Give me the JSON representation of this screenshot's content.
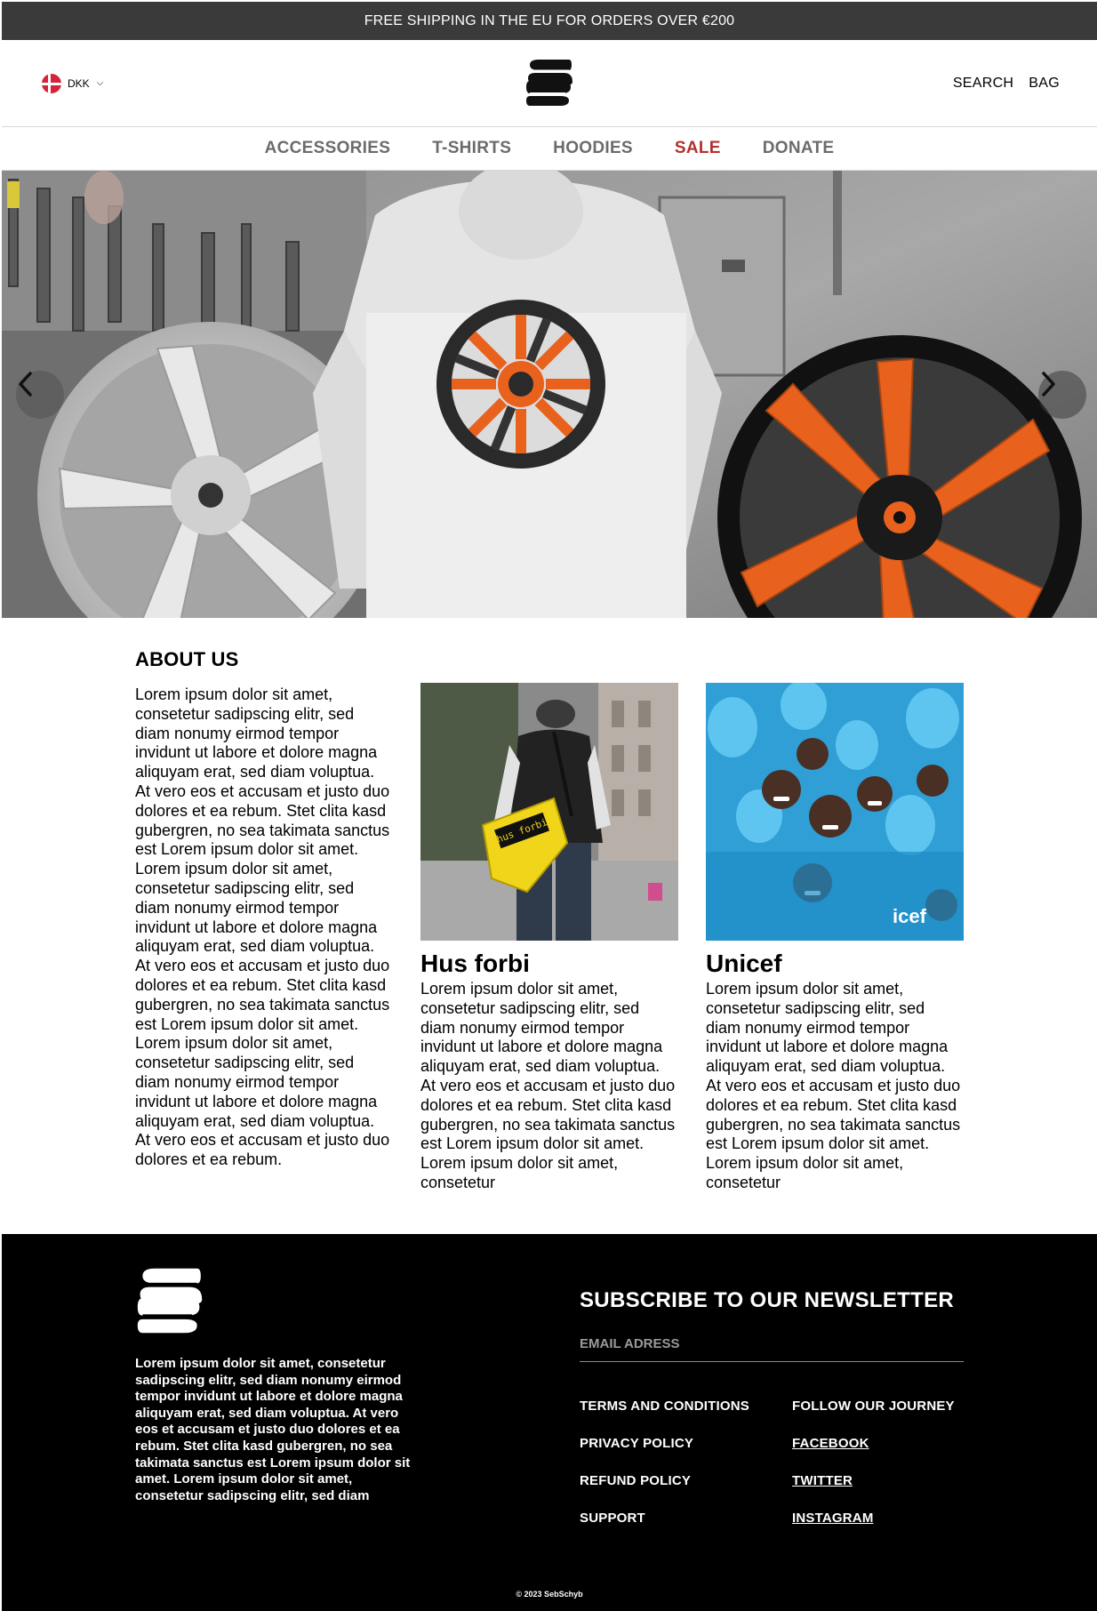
{
  "announcement": {
    "text": "FREE SHIPPING IN THE EU FOR ORDERS OVER €200"
  },
  "header": {
    "currency": "DKK",
    "search_label": "SEARCH",
    "bag_label": "BAG"
  },
  "nav": {
    "items": [
      {
        "label": "ACCESSORIES"
      },
      {
        "label": "T-SHIRTS"
      },
      {
        "label": "HOODIES"
      },
      {
        "label": "SALE"
      },
      {
        "label": "DONATE"
      }
    ]
  },
  "colors": {
    "announcement_bg": "#3a3a3a",
    "sale": "#b2302f",
    "nav_text": "#6b6b6b",
    "footer_bg": "#000000",
    "accent_orange": "#e8621e"
  },
  "about": {
    "title": "ABOUT US",
    "text": "Lorem ipsum dolor sit amet, consetetur sadipscing elitr, sed diam nonumy eirmod tempor invidunt ut labore et dolore magna aliquyam erat, sed diam voluptua. At vero eos et accusam et justo duo dolores et ea rebum. Stet clita kasd gubergren, no sea takimata sanctus est Lorem ipsum dolor sit amet. Lorem ipsum dolor sit amet, consetetur sadipscing elitr, sed diam nonumy eirmod tempor invidunt ut labore et dolore magna aliquyam erat, sed diam voluptua. At vero eos et accusam et justo duo dolores et ea rebum. Stet clita kasd gubergren, no sea takimata sanctus est Lorem ipsum dolor sit amet. Lorem ipsum dolor sit amet, consetetur sadipscing elitr, sed diam nonumy eirmod tempor invidunt ut labore et dolore magna aliquyam erat, sed diam voluptua. At vero eos et accusam et justo duo dolores et ea rebum."
  },
  "cards": [
    {
      "title": "Hus forbi",
      "bag_text": "hus forbi",
      "text": "Lorem ipsum dolor sit amet, consetetur sadipscing elitr, sed diam nonumy eirmod tempor invidunt ut labore et dolore magna aliquyam erat, sed diam voluptua. At vero eos et accusam et justo duo dolores et ea rebum. Stet clita kasd gubergren, no sea takimata sanctus est Lorem ipsum dolor sit amet. Lorem ipsum dolor sit amet, consetetur"
    },
    {
      "title": "Unicef",
      "text": "Lorem ipsum dolor sit amet, consetetur sadipscing elitr, sed diam nonumy eirmod tempor invidunt ut labore et dolore magna aliquyam erat, sed diam voluptua. At vero eos et accusam et justo duo dolores et ea rebum. Stet clita kasd gubergren, no sea takimata sanctus est Lorem ipsum dolor sit amet. Lorem ipsum dolor sit amet, consetetur"
    }
  ],
  "footer": {
    "text": "Lorem ipsum dolor sit amet, consetetur sadipscing elitr, sed diam nonumy eirmod tempor invidunt ut labore et dolore magna aliquyam erat, sed diam voluptua. At vero eos et accusam et justo duo dolores et ea rebum. Stet clita kasd gubergren, no sea takimata sanctus est Lorem ipsum dolor sit amet. Lorem ipsum dolor sit amet, consetetur sadipscing elitr, sed diam",
    "newsletter_title": "SUBSCRIBE TO OUR NEWSLETTER",
    "email_placeholder": "EMAIL ADRESS",
    "links_left": [
      "TERMS AND CONDITIONS",
      "PRIVACY POLICY",
      "REFUND POLICY",
      "SUPPORT"
    ],
    "follow_heading": "FOLLOW OUR JOURNEY",
    "social_links": [
      "FACEBOOK",
      "TWITTER",
      "INSTAGRAM"
    ],
    "copyright": "© 2023 SebSchyb"
  },
  "icons": {
    "logo": "stacked-s-logo-icon",
    "flag": "denmark-flag-icon",
    "chevron": "chevron-down-icon",
    "prev": "chevron-left-icon",
    "next": "chevron-right-icon"
  }
}
